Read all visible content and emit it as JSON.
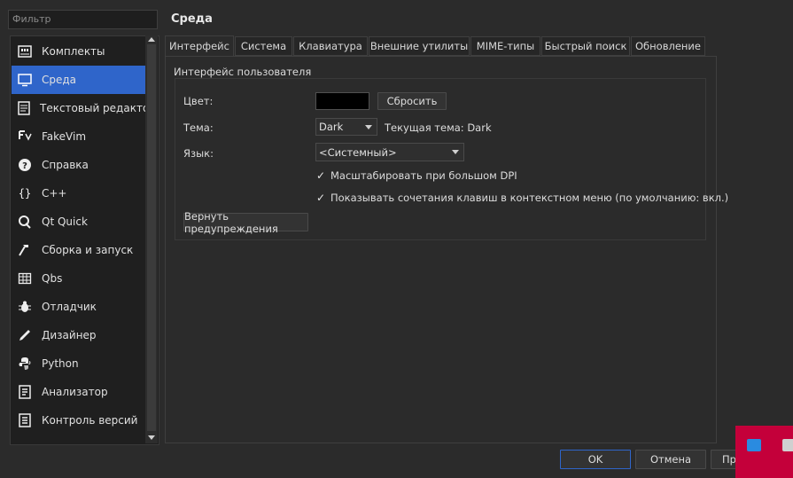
{
  "filter": {
    "placeholder": "Фильтр"
  },
  "sidebar": {
    "items": [
      {
        "label": "Комплекты",
        "icon": "kits-icon"
      },
      {
        "label": "Среда",
        "icon": "monitor-icon",
        "selected": true
      },
      {
        "label": "Текстовый редактор",
        "icon": "text-editor-icon"
      },
      {
        "label": "FakeVim",
        "icon": "fakevim-icon"
      },
      {
        "label": "Справка",
        "icon": "help-icon"
      },
      {
        "label": "C++",
        "icon": "braces-icon"
      },
      {
        "label": "Qt Quick",
        "icon": "qt-quick-icon"
      },
      {
        "label": "Сборка и запуск",
        "icon": "hammer-icon"
      },
      {
        "label": "Qbs",
        "icon": "qbs-icon"
      },
      {
        "label": "Отладчик",
        "icon": "bug-icon"
      },
      {
        "label": "Дизайнер",
        "icon": "pencil-icon"
      },
      {
        "label": "Python",
        "icon": "python-icon"
      },
      {
        "label": "Анализатор",
        "icon": "analyzer-icon"
      },
      {
        "label": "Контроль версий",
        "icon": "version-control-icon"
      }
    ]
  },
  "page": {
    "title": "Среда"
  },
  "tabs": [
    {
      "label": "Интерфейс",
      "active": true
    },
    {
      "label": "Система"
    },
    {
      "label": "Клавиатура"
    },
    {
      "label": "Внешние утилиты"
    },
    {
      "label": "MIME-типы"
    },
    {
      "label": "Быстрый поиск"
    },
    {
      "label": "Обновление"
    }
  ],
  "interface": {
    "group_title": "Интерфейс пользователя",
    "color_label": "Цвет:",
    "color_value": "#000000",
    "reset_button": "Сбросить",
    "theme_label": "Тема:",
    "theme_value": "Dark",
    "current_theme": "Текущая тема: Dark",
    "language_label": "Язык:",
    "language_value": "<Системный>",
    "checkboxes": [
      {
        "label": "Масштабировать при большом DPI",
        "checked": true
      },
      {
        "label": "Показывать сочетания клавиш в контекстном меню (по умолчанию: вкл.)",
        "checked": true
      }
    ],
    "restore_warnings_button": "Вернуть предупреждения"
  },
  "footer": {
    "ok": "OK",
    "cancel": "Отмена",
    "apply": "Пр"
  },
  "colors": {
    "accent": "#2f65ca",
    "background": "#2b2b2b",
    "taskbar_tile": "#c4003a"
  }
}
